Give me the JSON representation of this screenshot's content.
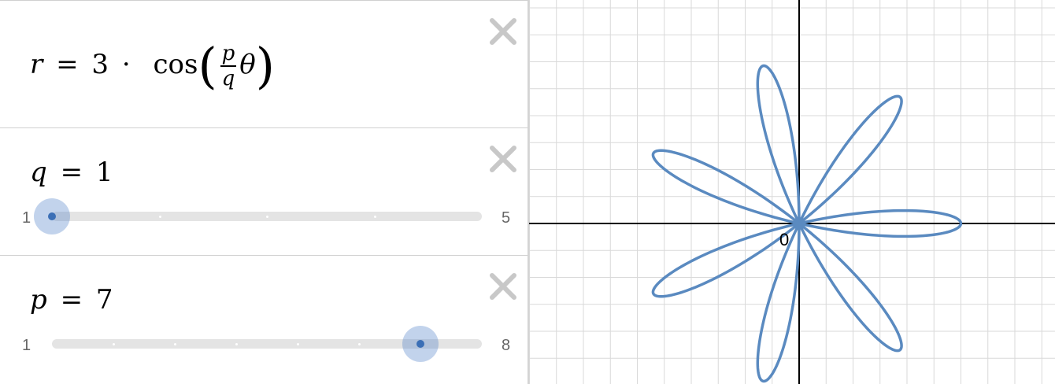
{
  "expressions": {
    "formula": {
      "lhs": "r",
      "equals": "=",
      "coef": "3",
      "dot": "·",
      "func": "cos",
      "frac_num": "p",
      "frac_den": "q",
      "theta": "θ"
    },
    "slider_q": {
      "name": "q",
      "equals": "=",
      "value": "1",
      "min": "1",
      "max": "5",
      "value_num": 1,
      "min_num": 1,
      "max_num": 5
    },
    "slider_p": {
      "name": "p",
      "equals": "=",
      "value": "7",
      "min": "1",
      "max": "8",
      "value_num": 7,
      "min_num": 1,
      "max_num": 8
    }
  },
  "graph": {
    "origin_label": "0",
    "curve_color": "#5a8ac0",
    "grid_color": "#d9d9d9",
    "axis_color": "#000000",
    "rose": {
      "amplitude": 3,
      "p": 7,
      "q": 1
    }
  },
  "icons": {
    "delete": "close-x-icon"
  }
}
